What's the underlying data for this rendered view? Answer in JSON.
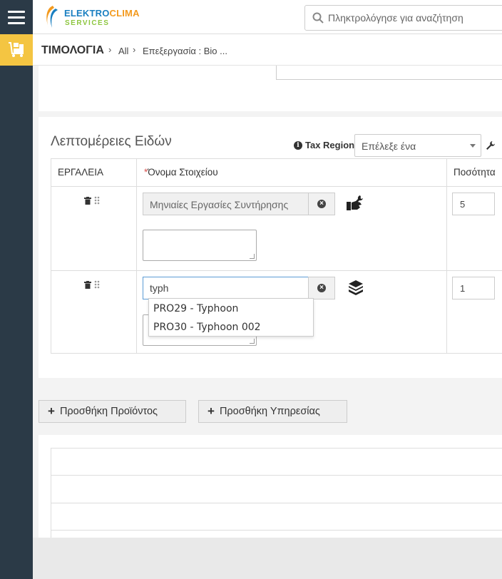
{
  "brand": {
    "name_part1": "ELEKTRO",
    "name_part2": "CLIMA",
    "name_line2": "SERVICES",
    "accent": "#f4c542",
    "rail": "#2b3a47"
  },
  "search": {
    "placeholder": "Πληκτρολόγησε για αναζήτηση"
  },
  "breadcrumb": {
    "module": "ΤΙΜΟΛΟΓΙΑ",
    "items": [
      "All",
      "Επεξεργασία : Bio ..."
    ]
  },
  "items_section": {
    "heading": "Λεπτομέρειες Ειδών",
    "tax_region_label": "Tax Region",
    "tax_region_value": "Επέλεξε ένα",
    "columns": {
      "tools": "ΕΡΓΑΛΕΙΑ",
      "required_mark": "*",
      "item_name": "Όνομα Στοιχείου",
      "quantity": "Ποσότητα"
    },
    "rows": [
      {
        "item_name": "Μηνιαίες Εργασίες Συντήρησης",
        "quantity": "5",
        "type_icon": "service-icon"
      },
      {
        "item_name": "typh",
        "quantity": "1",
        "type_icon": "product-icon"
      }
    ],
    "autocomplete": [
      "PRO29 - Typhoon",
      "PRO30 - Typhoon 002"
    ]
  },
  "actions": {
    "add_product": "Προσθήκη Προϊόντος",
    "add_service": "Προσθήκη Υπηρεσίας"
  }
}
